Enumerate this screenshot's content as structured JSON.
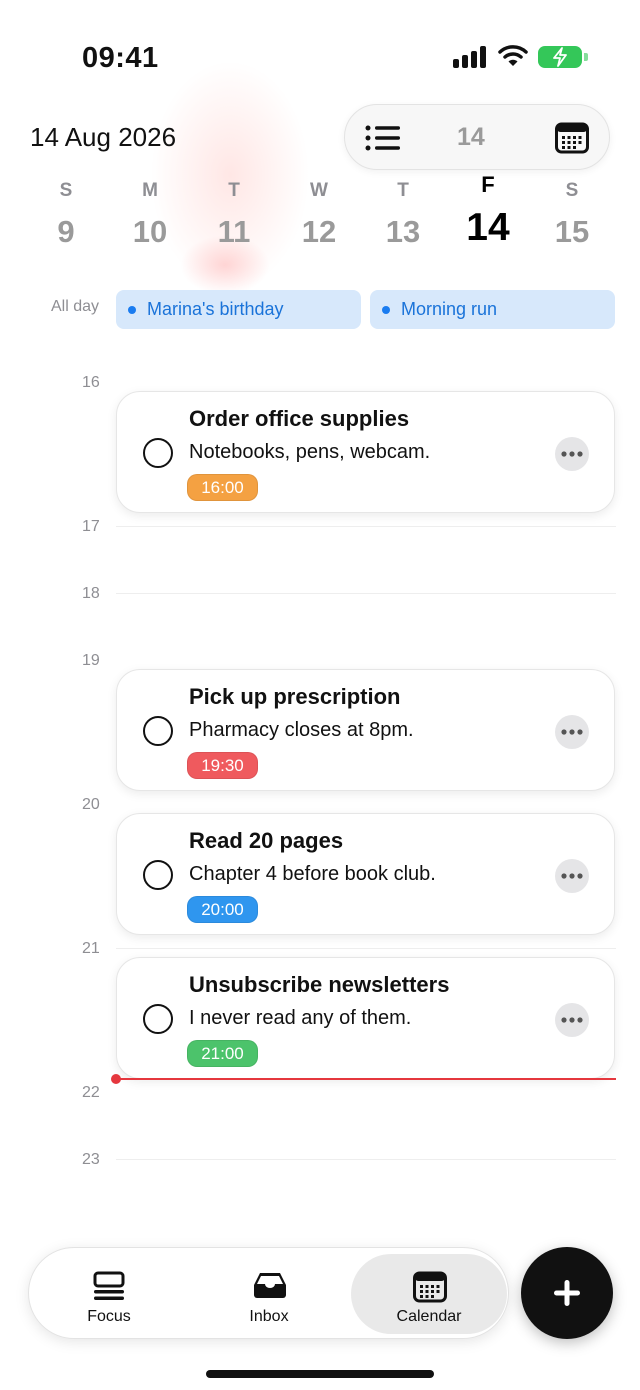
{
  "status_bar": {
    "time": "09:41"
  },
  "header": {
    "date": "14 Aug 2026",
    "selected_day": "14"
  },
  "week": [
    {
      "letter": "S",
      "day": "9"
    },
    {
      "letter": "M",
      "day": "10"
    },
    {
      "letter": "T",
      "day": "11"
    },
    {
      "letter": "W",
      "day": "12"
    },
    {
      "letter": "T",
      "day": "13"
    },
    {
      "letter": "F",
      "day": "14",
      "active": true
    },
    {
      "letter": "S",
      "day": "15"
    }
  ],
  "all_day": {
    "label": "All day",
    "events": [
      "Marina's birthday",
      "Morning run"
    ]
  },
  "hours": [
    "16",
    "17",
    "18",
    "19",
    "20",
    "21",
    "22",
    "23"
  ],
  "tasks": [
    {
      "title": "Order office supplies",
      "note": "Notebooks, pens, webcam.",
      "time": "16:00",
      "color": "#f4a142"
    },
    {
      "title": "Pick up prescription",
      "note": "Pharmacy closes at 8pm.",
      "time": "19:30",
      "color": "#ef5a5e"
    },
    {
      "title": "Read 20 pages",
      "note": "Chapter 4 before book club.",
      "time": "20:00",
      "color": "#2f96ef"
    },
    {
      "title": "Unsubscribe newsletters",
      "note": "I never read any of them.",
      "time": "21:00",
      "color": "#4cc36b"
    }
  ],
  "tabs": [
    {
      "label": "Focus",
      "icon": "focus-icon"
    },
    {
      "label": "Inbox",
      "icon": "inbox-icon"
    },
    {
      "label": "Calendar",
      "icon": "calendar-icon",
      "active": true
    }
  ],
  "colors": {
    "accent_blue": "#1a73d9",
    "now_line": "#e5373e",
    "battery": "#34c759"
  }
}
